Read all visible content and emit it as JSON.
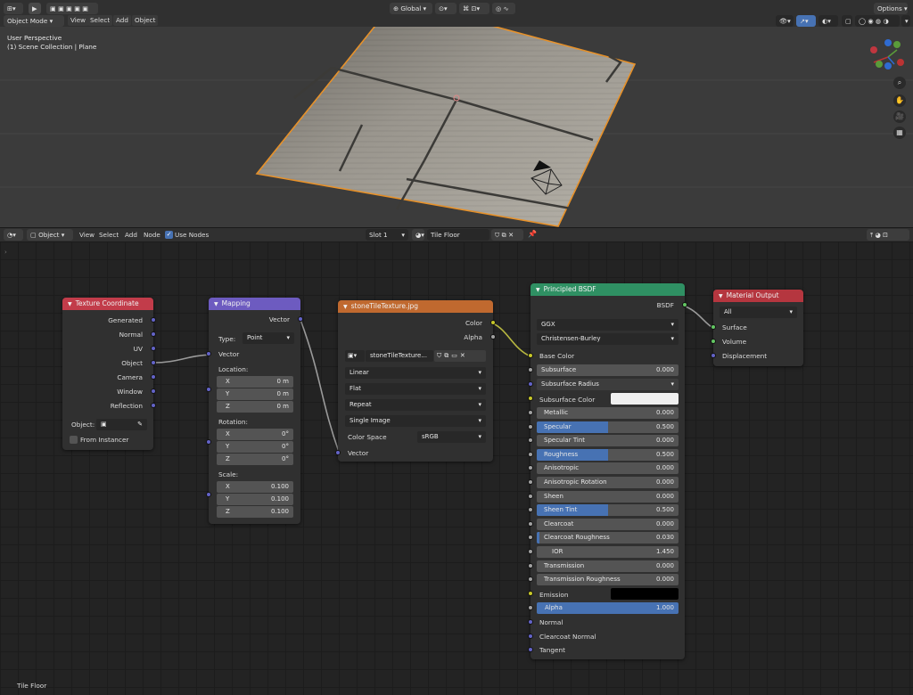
{
  "viewport": {
    "header": {
      "mode": "Object Mode",
      "menus": [
        "View",
        "Select",
        "Add",
        "Object"
      ],
      "transform_orientation": "Global",
      "options": "Options"
    },
    "overlay_text": [
      "User Perspective",
      "(1) Scene Collection | Plane"
    ],
    "gizmo_axes": {
      "x": "X",
      "y": "Y",
      "z": "Z"
    }
  },
  "node_editor": {
    "header": {
      "type": "Object",
      "menus": [
        "View",
        "Select",
        "Add",
        "Node"
      ],
      "use_nodes_label": "Use Nodes",
      "slot": "Slot 1",
      "material": "Tile Floor"
    },
    "footer_label": "Tile Floor",
    "nodes": {
      "texture_coordinate": {
        "title": "Texture Coordinate",
        "outputs": [
          "Generated",
          "Normal",
          "UV",
          "Object",
          "Camera",
          "Window",
          "Reflection"
        ],
        "object_label": "Object:",
        "from_instancer": "From Instancer"
      },
      "mapping": {
        "title": "Mapping",
        "output": "Vector",
        "type_label": "Type:",
        "type_value": "Point",
        "input": "Vector",
        "location_label": "Location:",
        "location": [
          {
            "axis": "X",
            "value": "0 m"
          },
          {
            "axis": "Y",
            "value": "0 m"
          },
          {
            "axis": "Z",
            "value": "0 m"
          }
        ],
        "rotation_label": "Rotation:",
        "rotation": [
          {
            "axis": "X",
            "value": "0°"
          },
          {
            "axis": "Y",
            "value": "0°"
          },
          {
            "axis": "Z",
            "value": "0°"
          }
        ],
        "scale_label": "Scale:",
        "scale": [
          {
            "axis": "X",
            "value": "0.100"
          },
          {
            "axis": "Y",
            "value": "0.100"
          },
          {
            "axis": "Z",
            "value": "0.100"
          }
        ]
      },
      "image_texture": {
        "title": "stoneTileTexture.jpg",
        "outputs": [
          "Color",
          "Alpha"
        ],
        "image_name": "stoneTileTexture...",
        "interpolation": "Linear",
        "projection": "Flat",
        "extension": "Repeat",
        "source": "Single Image",
        "color_space_label": "Color Space",
        "color_space": "sRGB",
        "input": "Vector"
      },
      "principled": {
        "title": "Principled BSDF",
        "distribution": "GGX",
        "subsurface_method": "Christensen-Burley",
        "base_color": "Base Color",
        "subsurface": {
          "label": "Subsurface",
          "value": "0.000"
        },
        "subsurface_radius": "Subsurface Radius",
        "subsurface_color": "Subsurface Color",
        "sliders": [
          {
            "label": "Metallic",
            "value": "0.000",
            "fill": 0
          },
          {
            "label": "Specular",
            "value": "0.500",
            "fill": 0.5
          },
          {
            "label": "Specular Tint",
            "value": "0.000",
            "fill": 0
          },
          {
            "label": "Roughness",
            "value": "0.500",
            "fill": 0.5
          },
          {
            "label": "Anisotropic",
            "value": "0.000",
            "fill": 0
          },
          {
            "label": "Anisotropic Rotation",
            "value": "0.000",
            "fill": 0
          },
          {
            "label": "Sheen",
            "value": "0.000",
            "fill": 0
          },
          {
            "label": "Sheen Tint",
            "value": "0.500",
            "fill": 0.5
          },
          {
            "label": "Clearcoat",
            "value": "0.000",
            "fill": 0
          },
          {
            "label": "Clearcoat Roughness",
            "value": "0.030",
            "fill": 0.03
          },
          {
            "label": "IOR",
            "value": "1.450",
            "fill": 0
          },
          {
            "label": "Transmission",
            "value": "0.000",
            "fill": 0
          },
          {
            "label": "Transmission Roughness",
            "value": "0.000",
            "fill": 0
          }
        ],
        "emission": "Emission",
        "alpha": {
          "label": "Alpha",
          "value": "1.000",
          "fill": 1
        },
        "normal": "Normal",
        "clearcoat_normal": "Clearcoat Normal",
        "tangent": "Tangent",
        "output": "BSDF"
      },
      "material_output": {
        "title": "Material Output",
        "target": "All",
        "inputs": [
          "Surface",
          "Volume",
          "Displacement"
        ]
      }
    }
  },
  "colors": {
    "texcoord_header": "#c23c4a",
    "mapping_header": "#6d5bc0",
    "image_header": "#c0692f",
    "bsdf_header": "#2f9063",
    "output_header": "#b5363f",
    "vector_socket": "#6363c7",
    "color_socket": "#c7c729",
    "float_socket": "#a1a1a1",
    "shader_socket": "#63c763",
    "slider_blue": "#4772b3"
  }
}
